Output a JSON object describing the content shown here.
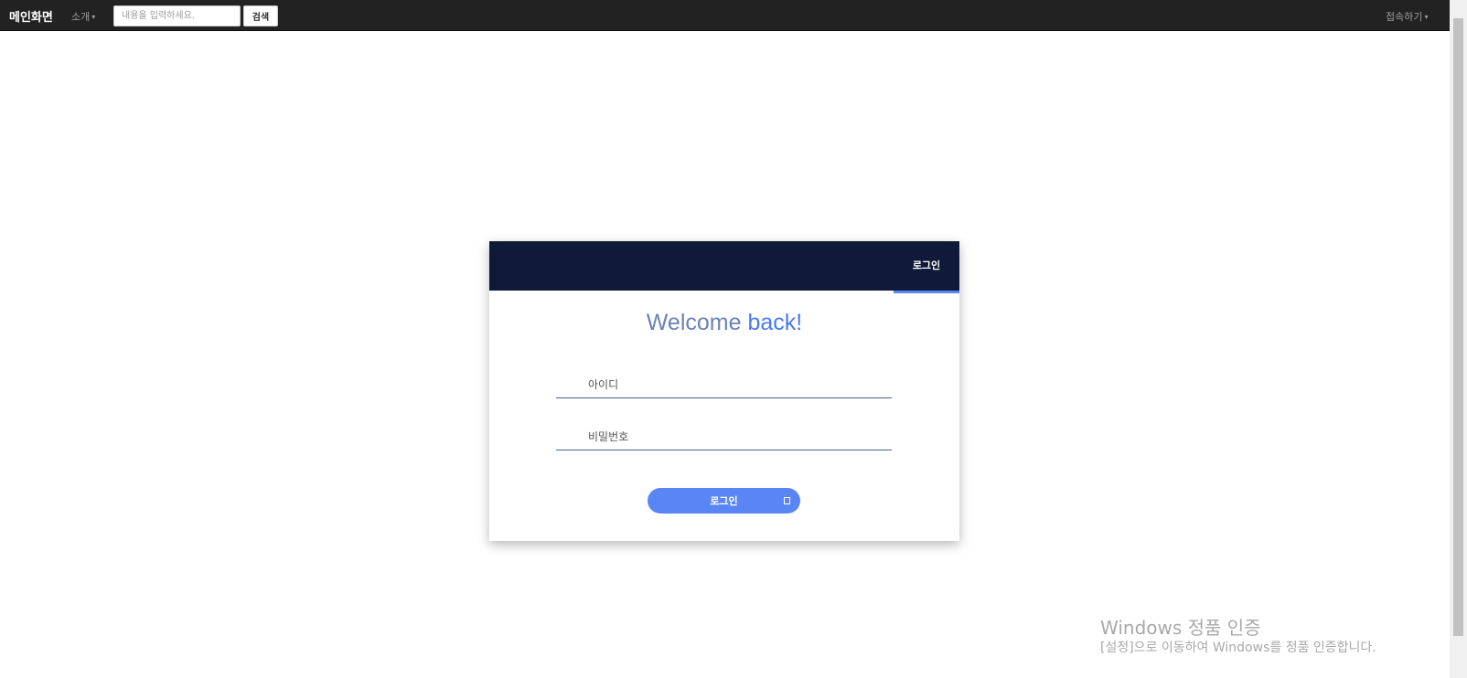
{
  "navbar": {
    "brand": "메인화면",
    "intro_menu": "소개",
    "search": {
      "placeholder": "내용을 입력하세요.",
      "value": "",
      "button_label": "검색"
    },
    "connect_menu": "접속하기"
  },
  "login_card": {
    "tab_label": "로그인",
    "welcome": {
      "part1": "Welcome",
      "part2": "back!"
    },
    "id_field": {
      "placeholder": "아이디",
      "value": ""
    },
    "password_field": {
      "placeholder": "비밀번호",
      "value": ""
    },
    "submit_label": "로그인",
    "submit_icon": "arrow-icon"
  },
  "watermark": {
    "title": "Windows 정품 인증",
    "subtitle": "[설정]으로 이동하여 Windows를 정품 인증합니다."
  },
  "colors": {
    "navbar_bg": "#222222",
    "card_header_bg": "#0f1a38",
    "accent": "#5a86f5",
    "welcome_gray": "#6a82b8",
    "welcome_blue": "#4a7af0"
  }
}
